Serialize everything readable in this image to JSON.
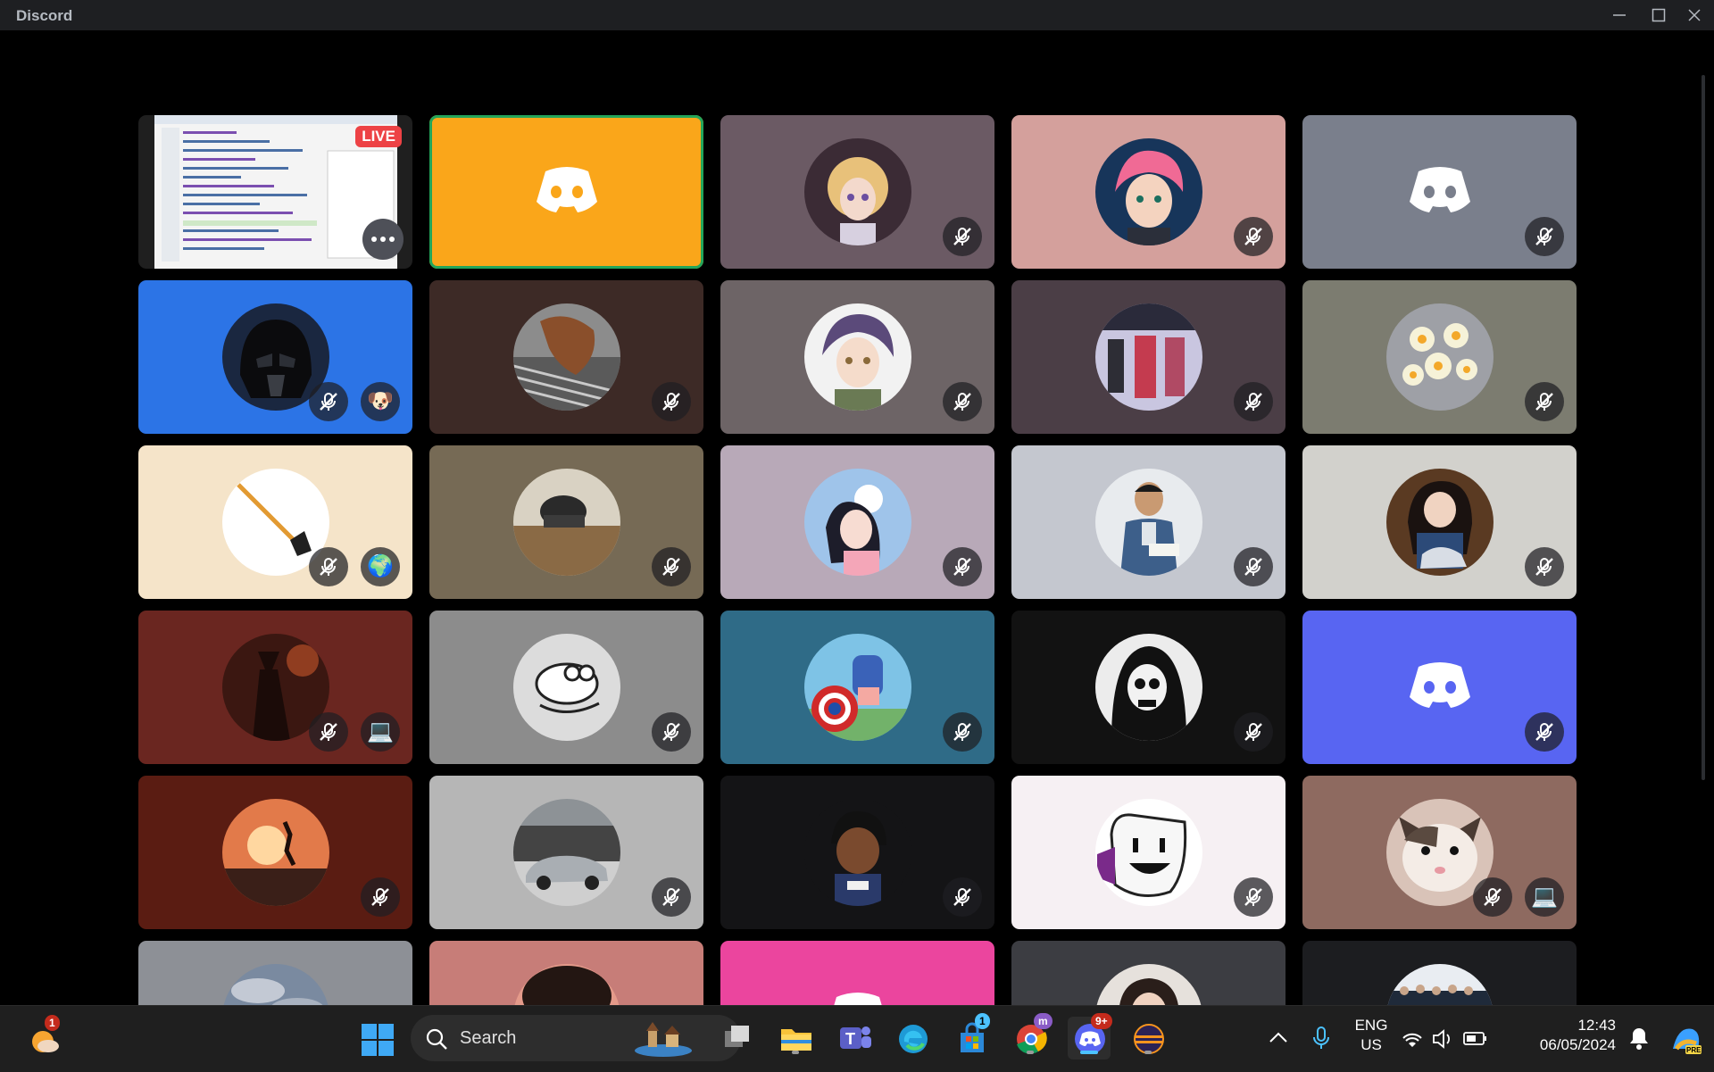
{
  "app": {
    "title": "Discord"
  },
  "colors": {
    "accent_blue": "#5865f2",
    "speaking_green": "#23a55a",
    "live_red": "#ed4245",
    "taskbar": "#1f1f1f"
  },
  "stream": {
    "live_label": "LIVE"
  },
  "participants": [
    {
      "tile": "stream",
      "bg": "#1f1f1f"
    },
    {
      "tile": "logo",
      "bg": "#faa61a",
      "speaking": true,
      "muted": false
    },
    {
      "tile": "avatar",
      "bg": "#6b5a64",
      "avatar": "anime-girl",
      "muted": true
    },
    {
      "tile": "avatar",
      "bg": "#d4a09c",
      "avatar": "anime-boy-pink",
      "muted": true
    },
    {
      "tile": "logo",
      "bg": "#7a7f8c",
      "muted": true
    },
    {
      "tile": "avatar",
      "bg": "#2c74e6",
      "avatar": "darth-vader",
      "muted": true,
      "activity": "dog-emoji"
    },
    {
      "tile": "avatar",
      "bg": "#3d2a26",
      "avatar": "horse",
      "muted": true
    },
    {
      "tile": "avatar",
      "bg": "#6d6466",
      "avatar": "anime-boy-purple",
      "muted": true
    },
    {
      "tile": "avatar",
      "bg": "#4b3e46",
      "avatar": "anime-scene",
      "muted": true
    },
    {
      "tile": "avatar",
      "bg": "#7c7c70",
      "avatar": "daffodils",
      "muted": true
    },
    {
      "tile": "avatar",
      "bg": "#f5e4c9",
      "avatar": "hoe",
      "muted": true,
      "activity": "globe-emoji"
    },
    {
      "tile": "avatar",
      "bg": "#766a55",
      "avatar": "person-desk",
      "muted": true
    },
    {
      "tile": "avatar",
      "bg": "#b8a9b8",
      "avatar": "anime-girl-dog",
      "muted": true
    },
    {
      "tile": "avatar",
      "bg": "#c4c7cf",
      "avatar": "man-book",
      "muted": true
    },
    {
      "tile": "avatar",
      "bg": "#d2d1cc",
      "avatar": "girl-guitar",
      "muted": true
    },
    {
      "tile": "avatar",
      "bg": "#6a2620",
      "avatar": "witch",
      "muted": true,
      "activity": "laptop-emoji"
    },
    {
      "tile": "avatar",
      "bg": "#8c8c8c",
      "avatar": "sketch-cartoon",
      "muted": true
    },
    {
      "tile": "avatar",
      "bg": "#2f6b87",
      "avatar": "captain-america",
      "muted": true
    },
    {
      "tile": "avatar",
      "bg": "#121212",
      "avatar": "skull-hood",
      "muted": true
    },
    {
      "tile": "logo",
      "bg": "#5865f2",
      "muted": true
    },
    {
      "tile": "avatar",
      "bg": "#5a1c12",
      "avatar": "sunset-run",
      "muted": true
    },
    {
      "tile": "avatar",
      "bg": "#b6b6b6",
      "avatar": "sports-car",
      "muted": true
    },
    {
      "tile": "avatar",
      "bg": "#141416",
      "avatar": "cartoon-boy",
      "muted": true
    },
    {
      "tile": "avatar",
      "bg": "#f6f0f3",
      "avatar": "smile-mask",
      "muted": true
    },
    {
      "tile": "avatar",
      "bg": "#8e6a60",
      "avatar": "cat",
      "muted": true,
      "activity": "laptop-emoji"
    },
    {
      "tile": "avatar",
      "bg": "#8d9096",
      "avatar": "sky",
      "muted": false
    },
    {
      "tile": "avatar",
      "bg": "#c77d78",
      "avatar": "sunset-tree",
      "muted": false
    },
    {
      "tile": "logo",
      "bg": "#eb459e",
      "muted": false
    },
    {
      "tile": "avatar",
      "bg": "#3c3d42",
      "avatar": "woman-face",
      "muted": false
    },
    {
      "tile": "avatar",
      "bg": "#1c1d20",
      "avatar": "group-photo",
      "muted": false
    }
  ],
  "taskbar": {
    "search_placeholder": "Search",
    "weather_badge": "1",
    "store_badge": "1",
    "discord_badge": "9+",
    "chrome_badge": "m",
    "language": "ENG",
    "region": "US",
    "time": "12:43",
    "date": "06/05/2024"
  }
}
